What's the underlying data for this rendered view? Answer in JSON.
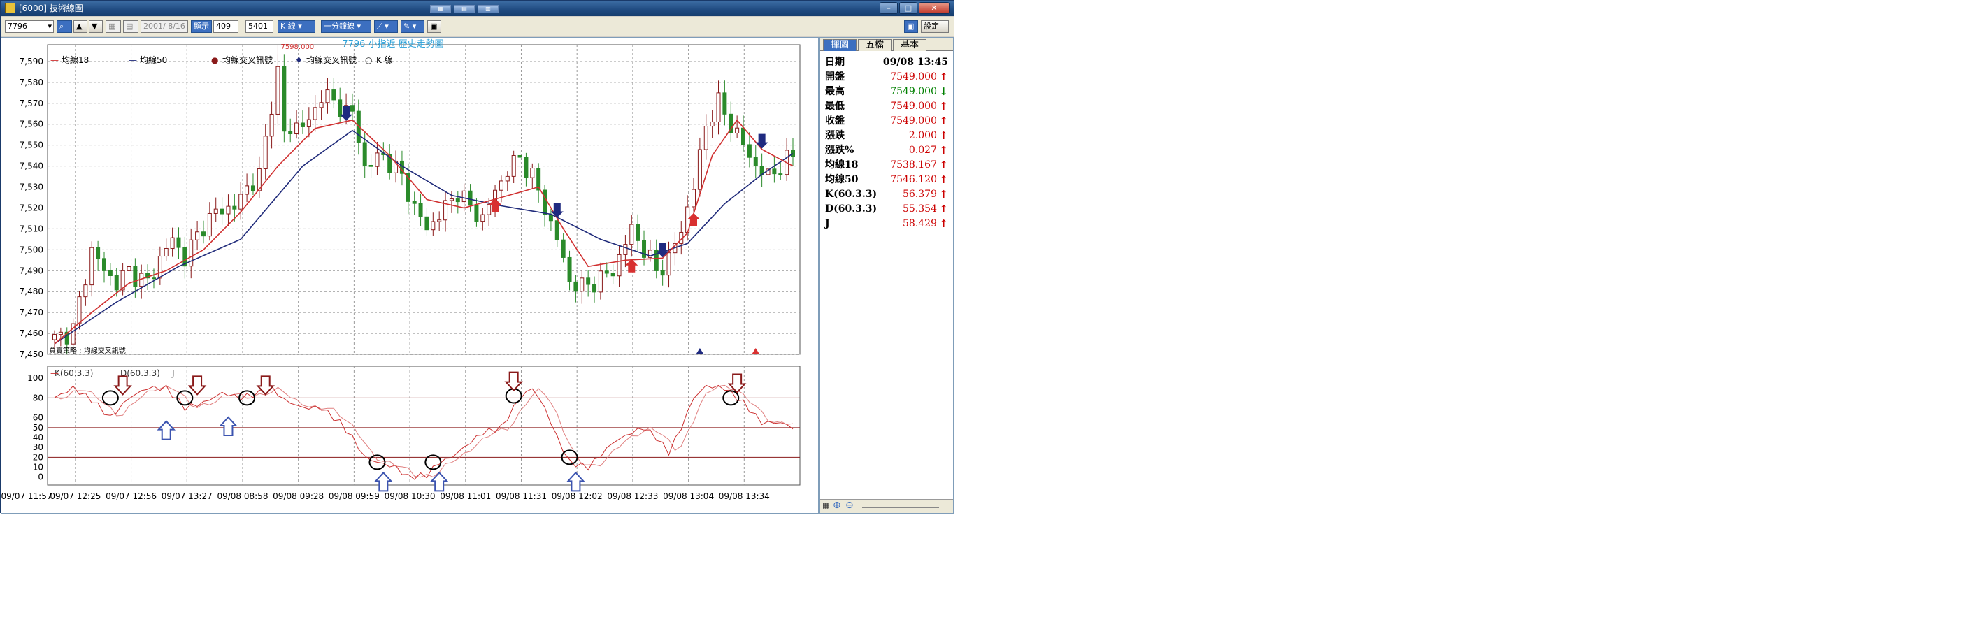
{
  "window": {
    "title": "[6000] 技術線圖",
    "icon": "app-icon",
    "buttons": [
      "minimize-icon",
      "maximize-icon",
      "close-icon"
    ]
  },
  "toolbar": {
    "symbol_value": "7796",
    "date_value": "2001/ 8/16",
    "display_label": "顯示",
    "display_value": "409",
    "count_value": "5401",
    "chart_type": "K 線",
    "interval": "一分鐘線",
    "settings_label": "設定"
  },
  "chart_data": [
    {
      "type": "candlestick",
      "title": "7796 小指近   歷史走勢圖",
      "legend": [
        "均線18",
        "均線50",
        "均線交叉訊號",
        "均線交叉訊號",
        "K 線"
      ],
      "ylim": [
        7450,
        7598
      ],
      "yticks": [
        7450,
        7460,
        7470,
        7480,
        7490,
        7500,
        7510,
        7520,
        7530,
        7540,
        7550,
        7560,
        7570,
        7580,
        7590
      ],
      "peak_label": "7598.000",
      "strategy_label": "買賣策略 : 均線交叉訊號",
      "close_path": [
        [
          0,
          7457
        ],
        [
          3,
          7462
        ],
        [
          6,
          7500
        ],
        [
          8,
          7490
        ],
        [
          10,
          7484
        ],
        [
          12,
          7490
        ],
        [
          15,
          7484
        ],
        [
          17,
          7496
        ],
        [
          19,
          7505
        ],
        [
          21,
          7496
        ],
        [
          24,
          7512
        ],
        [
          27,
          7520
        ],
        [
          29,
          7520
        ],
        [
          31,
          7530
        ],
        [
          33,
          7535
        ],
        [
          35,
          7570
        ],
        [
          36,
          7585
        ],
        [
          37,
          7555
        ],
        [
          39,
          7560
        ],
        [
          41,
          7560
        ],
        [
          43,
          7575
        ],
        [
          45,
          7570
        ],
        [
          48,
          7565
        ],
        [
          50,
          7540
        ],
        [
          53,
          7545
        ],
        [
          56,
          7535
        ],
        [
          58,
          7520
        ],
        [
          60,
          7510
        ],
        [
          63,
          7520
        ],
        [
          65,
          7528
        ],
        [
          67,
          7520
        ],
        [
          69,
          7515
        ],
        [
          71,
          7528
        ],
        [
          73,
          7538
        ],
        [
          75,
          7544
        ],
        [
          77,
          7535
        ],
        [
          79,
          7520
        ],
        [
          81,
          7505
        ],
        [
          83,
          7485
        ],
        [
          85,
          7482
        ],
        [
          88,
          7486
        ],
        [
          90,
          7490
        ],
        [
          93,
          7510
        ],
        [
          95,
          7500
        ],
        [
          97,
          7490
        ],
        [
          99,
          7495
        ],
        [
          101,
          7510
        ],
        [
          103,
          7530
        ],
        [
          105,
          7560
        ],
        [
          107,
          7570
        ],
        [
          109,
          7560
        ],
        [
          111,
          7550
        ],
        [
          113,
          7540
        ],
        [
          115,
          7535
        ],
        [
          117,
          7540
        ],
        [
          119,
          7545
        ]
      ],
      "ma18_path": [
        [
          0,
          7455
        ],
        [
          6,
          7470
        ],
        [
          12,
          7484
        ],
        [
          18,
          7490
        ],
        [
          24,
          7500
        ],
        [
          30,
          7518
        ],
        [
          36,
          7540
        ],
        [
          42,
          7558
        ],
        [
          48,
          7562
        ],
        [
          54,
          7545
        ],
        [
          60,
          7524
        ],
        [
          66,
          7520
        ],
        [
          72,
          7525
        ],
        [
          78,
          7530
        ],
        [
          82,
          7510
        ],
        [
          86,
          7492
        ],
        [
          92,
          7495
        ],
        [
          98,
          7496
        ],
        [
          102,
          7508
        ],
        [
          106,
          7545
        ],
        [
          110,
          7562
        ],
        [
          114,
          7548
        ],
        [
          119,
          7540
        ]
      ],
      "ma50_path": [
        [
          0,
          7455
        ],
        [
          10,
          7475
        ],
        [
          20,
          7492
        ],
        [
          30,
          7505
        ],
        [
          40,
          7540
        ],
        [
          48,
          7557
        ],
        [
          56,
          7540
        ],
        [
          64,
          7526
        ],
        [
          72,
          7521
        ],
        [
          80,
          7517
        ],
        [
          88,
          7505
        ],
        [
          96,
          7497
        ],
        [
          102,
          7503
        ],
        [
          108,
          7522
        ],
        [
          114,
          7536
        ],
        [
          119,
          7546
        ]
      ],
      "signals": [
        {
          "i": 47,
          "dir": "down"
        },
        {
          "i": 71,
          "dir": "up"
        },
        {
          "i": 81,
          "dir": "down"
        },
        {
          "i": 93,
          "dir": "up"
        },
        {
          "i": 98,
          "dir": "down"
        },
        {
          "i": 103,
          "dir": "up"
        },
        {
          "i": 114,
          "dir": "down"
        }
      ],
      "bottom_markers": [
        {
          "i": 104,
          "color": "#1f2a80"
        },
        {
          "i": 113,
          "color": "#d83030"
        }
      ]
    },
    {
      "type": "line",
      "legend": [
        "K(60.3.3)",
        "D(60.3.3)",
        "J"
      ],
      "ylim": [
        -8,
        112
      ],
      "yticks": [
        0,
        10,
        20,
        30,
        40,
        50,
        60,
        80,
        100
      ],
      "reference_lines": [
        20,
        50,
        80
      ],
      "k_path": [
        [
          0,
          80
        ],
        [
          3,
          90
        ],
        [
          6,
          78
        ],
        [
          9,
          60
        ],
        [
          12,
          80
        ],
        [
          15,
          90
        ],
        [
          18,
          90
        ],
        [
          21,
          70
        ],
        [
          24,
          75
        ],
        [
          27,
          85
        ],
        [
          30,
          80
        ],
        [
          33,
          85
        ],
        [
          35,
          90
        ],
        [
          37,
          78
        ],
        [
          40,
          70
        ],
        [
          43,
          70
        ],
        [
          46,
          55
        ],
        [
          48,
          40
        ],
        [
          50,
          20
        ],
        [
          52,
          15
        ],
        [
          55,
          10
        ],
        [
          57,
          0
        ],
        [
          60,
          2
        ],
        [
          62,
          15
        ],
        [
          64,
          20
        ],
        [
          66,
          30
        ],
        [
          69,
          45
        ],
        [
          72,
          50
        ],
        [
          75,
          80
        ],
        [
          77,
          90
        ],
        [
          79,
          70
        ],
        [
          81,
          40
        ],
        [
          83,
          15
        ],
        [
          86,
          10
        ],
        [
          88,
          22
        ],
        [
          90,
          35
        ],
        [
          93,
          45
        ],
        [
          95,
          50
        ],
        [
          97,
          40
        ],
        [
          99,
          25
        ],
        [
          101,
          50
        ],
        [
          103,
          80
        ],
        [
          105,
          92
        ],
        [
          108,
          90
        ],
        [
          111,
          75
        ],
        [
          114,
          55
        ],
        [
          117,
          55
        ],
        [
          119,
          50
        ]
      ],
      "x_labels": [
        "09/07 11:57",
        "09/07 12:25",
        "09/07 12:56",
        "09/07 13:27",
        "09/08 08:58",
        "09/08 09:28",
        "09/08 09:59",
        "09/08 10:30",
        "09/08 11:01",
        "09/08 11:31",
        "09/08 12:02",
        "09/08 12:33",
        "09/08 13:04",
        "09/08 13:34"
      ],
      "circles": [
        {
          "i": 9,
          "v": 80
        },
        {
          "i": 21,
          "v": 80
        },
        {
          "i": 31,
          "v": 80
        },
        {
          "i": 52,
          "v": 15
        },
        {
          "i": 61,
          "v": 15
        },
        {
          "i": 74,
          "v": 82
        },
        {
          "i": 83,
          "v": 20
        },
        {
          "i": 109,
          "v": 80
        }
      ],
      "arrows": [
        {
          "i": 11,
          "v": 92,
          "dir": "down",
          "color": "#8a1a1a"
        },
        {
          "i": 23,
          "v": 92,
          "dir": "down",
          "color": "#8a1a1a"
        },
        {
          "i": 34,
          "v": 92,
          "dir": "down",
          "color": "#8a1a1a"
        },
        {
          "i": 74,
          "v": 96,
          "dir": "down",
          "color": "#8a1a1a"
        },
        {
          "i": 110,
          "v": 94,
          "dir": "down",
          "color": "#8a1a1a"
        },
        {
          "i": 18,
          "v": 48,
          "dir": "up",
          "color": "#3c54b0"
        },
        {
          "i": 28,
          "v": 52,
          "dir": "up",
          "color": "#3c54b0"
        },
        {
          "i": 53,
          "v": -4,
          "dir": "up",
          "color": "#3c54b0"
        },
        {
          "i": 62,
          "v": -4,
          "dir": "up",
          "color": "#3c54b0"
        },
        {
          "i": 84,
          "v": -4,
          "dir": "up",
          "color": "#3c54b0"
        }
      ]
    }
  ],
  "side": {
    "tabs": [
      "揮圖",
      "五檔",
      "基本"
    ],
    "quote_rows": [
      {
        "label": "日期",
        "value": "09/08 13:45",
        "arrow": "",
        "color": "#000000"
      },
      {
        "label": "開盤",
        "value": "7549.000",
        "arrow": "↑",
        "color": "#cc0000"
      },
      {
        "label": "最高",
        "value": "7549.000",
        "arrow": "↓",
        "color": "#008000"
      },
      {
        "label": "最低",
        "value": "7549.000",
        "arrow": "↑",
        "color": "#cc0000"
      },
      {
        "label": "收盤",
        "value": "7549.000",
        "arrow": "↑",
        "color": "#cc0000"
      },
      {
        "label": "漲跌",
        "value": "2.000",
        "arrow": "↑",
        "color": "#cc0000"
      },
      {
        "label": "漲跌%",
        "value": "0.027",
        "arrow": "↑",
        "color": "#cc0000"
      },
      {
        "label": "均線18",
        "value": "7538.167",
        "arrow": "↑",
        "color": "#cc0000"
      },
      {
        "label": "均線50",
        "value": "7546.120",
        "arrow": "↑",
        "color": "#cc0000"
      },
      {
        "label": "K(60.3.3)",
        "value": "56.379",
        "arrow": "↑",
        "color": "#cc0000"
      },
      {
        "label": "D(60.3.3)",
        "value": "55.354",
        "arrow": "↑",
        "color": "#cc0000"
      },
      {
        "label": "J",
        "value": "58.429",
        "arrow": "↑",
        "color": "#cc0000"
      }
    ]
  },
  "colors": {
    "ma18": "#d03030",
    "ma50": "#1f2a7a",
    "kd": "#cc3030",
    "candle_up": "#8a1a1a",
    "candle_down": "#2a8a2a",
    "ref": "#8a1a1a",
    "grid": "#9a9a9a",
    "title": "#2aa0d8"
  }
}
